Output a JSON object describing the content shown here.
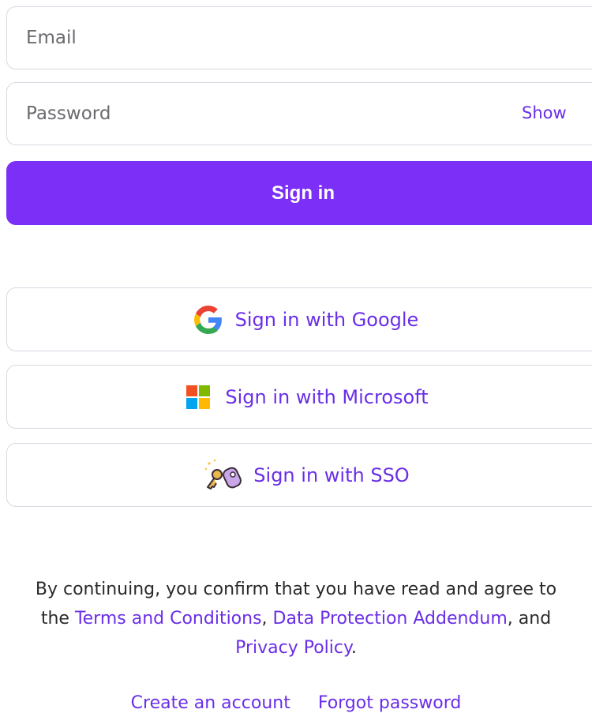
{
  "form": {
    "email": {
      "value": "",
      "placeholder": "Email"
    },
    "password": {
      "value": "",
      "placeholder": "Password",
      "toggle_label": "Show"
    },
    "submit_label": "Sign in"
  },
  "providers": [
    {
      "label": "Sign in with Google",
      "icon": "google-icon"
    },
    {
      "label": "Sign in with Microsoft",
      "icon": "microsoft-icon"
    },
    {
      "label": "Sign in with SSO",
      "icon": "key-icon"
    }
  ],
  "legal": {
    "line_1": "By continuing, you confirm that you have read and agree to",
    "the": "the",
    "terms": "Terms and Conditions",
    "sep_1": ",",
    "dpa": "Data Protection Addendum",
    "sep_2": ", and",
    "privacy": "Privacy Policy",
    "end": "."
  },
  "footer": {
    "create_account": "Create an account",
    "forgot_password": "Forgot password"
  },
  "colors": {
    "accent": "#7b2ff7",
    "link": "#6a2ee8",
    "border": "#d9d9e3"
  }
}
